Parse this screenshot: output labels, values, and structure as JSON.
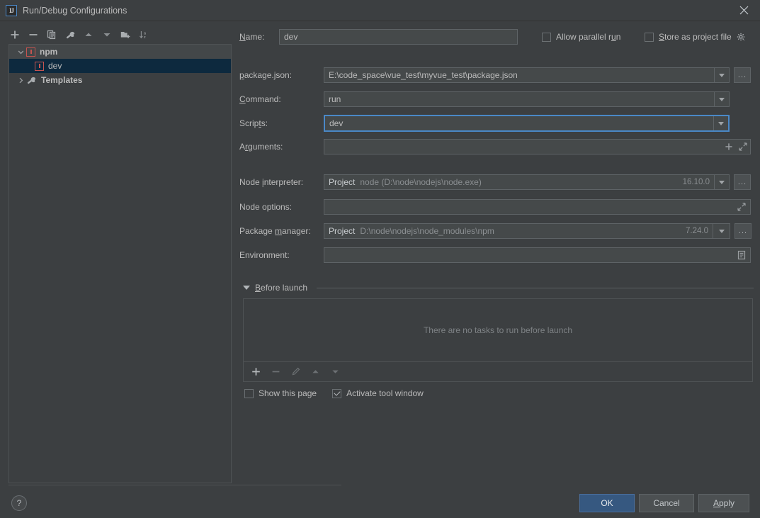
{
  "window": {
    "title": "Run/Debug Configurations",
    "logo_text": "IJ",
    "close_icon": "close-icon"
  },
  "tree_toolbar": {
    "buttons": [
      {
        "name": "add-configuration-button",
        "icon": "plus-icon",
        "tooltip": "Add New Configuration"
      },
      {
        "name": "remove-configuration-button",
        "icon": "minus-icon",
        "tooltip": "Remove Configuration"
      },
      {
        "name": "copy-configuration-button",
        "icon": "copy-icon",
        "tooltip": "Copy Configuration"
      },
      {
        "name": "edit-templates-button",
        "icon": "wrench-icon",
        "tooltip": "Edit Templates"
      },
      {
        "name": "move-up-button",
        "icon": "arrow-up-icon",
        "tooltip": "Move Up"
      },
      {
        "name": "move-down-button",
        "icon": "arrow-down-icon",
        "tooltip": "Move Down"
      },
      {
        "name": "new-folder-button",
        "icon": "folder-add-icon",
        "tooltip": "Create New Folder"
      },
      {
        "name": "sort-button",
        "icon": "sort-alphabetically-icon",
        "tooltip": "Sort Configurations"
      }
    ]
  },
  "tree": {
    "nodes": [
      {
        "label": "npm",
        "icon": "npm-icon",
        "expanded": true,
        "selected": false,
        "level": 0,
        "bold": true
      },
      {
        "label": "dev",
        "icon": "npm-icon",
        "expanded": null,
        "selected": true,
        "level": 1,
        "bold": false
      },
      {
        "label": "Templates",
        "icon": "wrench-icon",
        "expanded": false,
        "selected": false,
        "level": 0,
        "bold": true
      }
    ]
  },
  "form": {
    "name": {
      "label": "Name:",
      "label_mnemonic": "N",
      "value": "dev"
    },
    "allow_parallel_run": {
      "label": "Allow parallel run",
      "checked": false
    },
    "store_as_project_file": {
      "label": "Store as project file",
      "checked": false,
      "gear_icon": "gear-icon"
    },
    "package_json": {
      "label": "package.json:",
      "value": "E:\\code_space\\vue_test\\myvue_test\\package.json",
      "has_dropdown": true,
      "browse_label": "..."
    },
    "command": {
      "label": "Command:",
      "value": "run",
      "has_dropdown": true
    },
    "scripts": {
      "label": "Scripts:",
      "value": "dev",
      "has_dropdown": true,
      "focused": true
    },
    "arguments": {
      "label": "Arguments:",
      "value": "",
      "add_icon": "plus-icon",
      "expand_icon": "expand-icon"
    },
    "node_interpreter": {
      "label": "Node interpreter:",
      "scope": "Project",
      "value": "node (D:\\node\\nodejs\\node.exe)",
      "version": "16.10.0",
      "has_dropdown": true,
      "browse_label": "..."
    },
    "node_options": {
      "label": "Node options:",
      "value": "",
      "expand_icon": "expand-icon"
    },
    "package_manager": {
      "label": "Package manager:",
      "scope": "Project",
      "value": "D:\\node\\nodejs\\node_modules\\npm",
      "version": "7.24.0",
      "has_dropdown": true,
      "browse_label": "..."
    },
    "environment": {
      "label": "Environment:",
      "value": "",
      "edit_icon": "list-edit-icon"
    }
  },
  "before_launch": {
    "title": "Before launch",
    "empty_message": "There are no tasks to run before launch",
    "toolbar": [
      {
        "name": "add-task-button",
        "icon": "plus-icon",
        "enabled": true
      },
      {
        "name": "remove-task-button",
        "icon": "minus-icon",
        "enabled": false
      },
      {
        "name": "edit-task-button",
        "icon": "pencil-icon",
        "enabled": false
      },
      {
        "name": "move-task-up-button",
        "icon": "arrow-up-icon",
        "enabled": false
      },
      {
        "name": "move-task-down-button",
        "icon": "arrow-down-icon",
        "enabled": false
      }
    ],
    "show_this_page": {
      "label": "Show this page",
      "checked": false
    },
    "activate_tool_window": {
      "label": "Activate tool window",
      "checked": true
    }
  },
  "footer": {
    "help_label": "?",
    "ok_label": "OK",
    "cancel_label": "Cancel",
    "apply_label": "Apply"
  },
  "colors": {
    "background": "#3c3f41",
    "field_background": "#45494a",
    "accent_blue": "#4a88c7",
    "primary_button": "#365880",
    "selection": "#0d293e",
    "npm_red": "#c75450",
    "text": "#bbbbbb",
    "muted_text": "#8a8e91"
  }
}
